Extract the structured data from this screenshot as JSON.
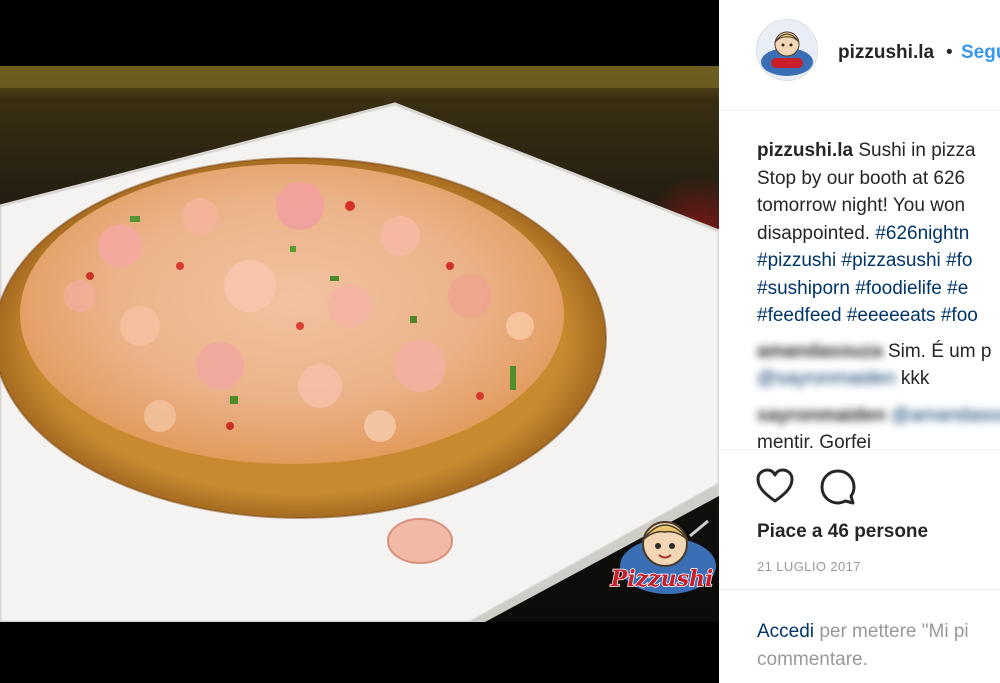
{
  "post": {
    "username": "pizzushi.la",
    "dot": "•",
    "follow_label": "Segui",
    "caption": {
      "username": "pizzushi.la",
      "lines": [
        "Sushi in pizza",
        "Stop by our booth at 626",
        "tomorrow night! You won",
        "disappointed."
      ],
      "first_tag": "#626nightn",
      "hashtag_lines": [
        [
          "#pizzushi",
          "#pizzasushi",
          "#fo"
        ],
        [
          "#sushiporn",
          "#foodielife",
          "#e"
        ],
        [
          "#feedfeed",
          "#eeeeeats",
          "#foo"
        ]
      ]
    },
    "comments": [
      {
        "user": "amandasouza",
        "text": "Sim. É um p",
        "line2_mention": "@sayronmaiden",
        "line2_text": "kkk"
      },
      {
        "user": "sayronmaiden",
        "mention": "@amandasouza",
        "line2_text": "mentir. Gorfei"
      }
    ],
    "likes_text": "Piace a 46 persone",
    "date": "21 LUGLIO 2017",
    "login": {
      "link": "Accedi",
      "line1_rest": "per mettere \"Mi pi",
      "line2": "commentare."
    }
  },
  "photo": {
    "watermark": "Pizzushi"
  },
  "icons": {
    "like": "heart-icon",
    "comment": "comment-icon"
  },
  "colors": {
    "link_blue": "#3897f0",
    "hashtag_navy": "#003569",
    "muted_gray": "#999999",
    "text": "#262626"
  }
}
